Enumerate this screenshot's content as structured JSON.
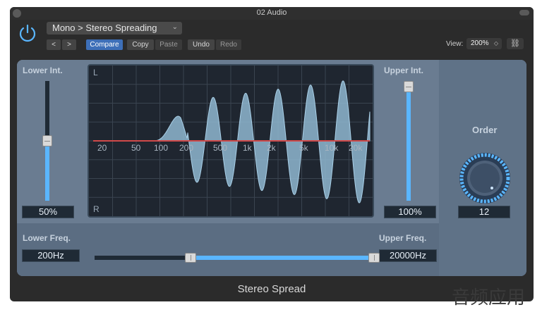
{
  "window": {
    "title": "02 Audio"
  },
  "header": {
    "preset": "Mono > Stereo Spreading",
    "nav": {
      "prev": "<",
      "next": ">"
    },
    "buttons": {
      "compare": "Compare",
      "copy": "Copy",
      "paste": "Paste",
      "undo": "Undo",
      "redo": "Redo"
    },
    "view": {
      "label": "View:",
      "value": "200%"
    }
  },
  "plugin": {
    "lower_int": {
      "label": "Lower Int.",
      "value": "50%",
      "level": 0.5
    },
    "upper_int": {
      "label": "Upper Int.",
      "value": "100%",
      "level": 1.0
    },
    "order": {
      "label": "Order",
      "value": "12"
    },
    "lower_freq": {
      "label": "Lower Freq.",
      "value": "200Hz"
    },
    "upper_freq": {
      "label": "Upper Freq.",
      "value": "20000Hz"
    },
    "display": {
      "top_label": "L",
      "bottom_label": "R",
      "freq_ticks": [
        "20",
        "50",
        "100",
        "200",
        "500",
        "1k",
        "2k",
        "5k",
        "10k",
        "20k"
      ]
    },
    "name": "Stereo Spread"
  },
  "watermark": "音频应用",
  "colors": {
    "accent": "#5ab6ff",
    "panel": "#6b7d92",
    "display_bg": "#1f2630",
    "curve": "#d04a4a"
  }
}
